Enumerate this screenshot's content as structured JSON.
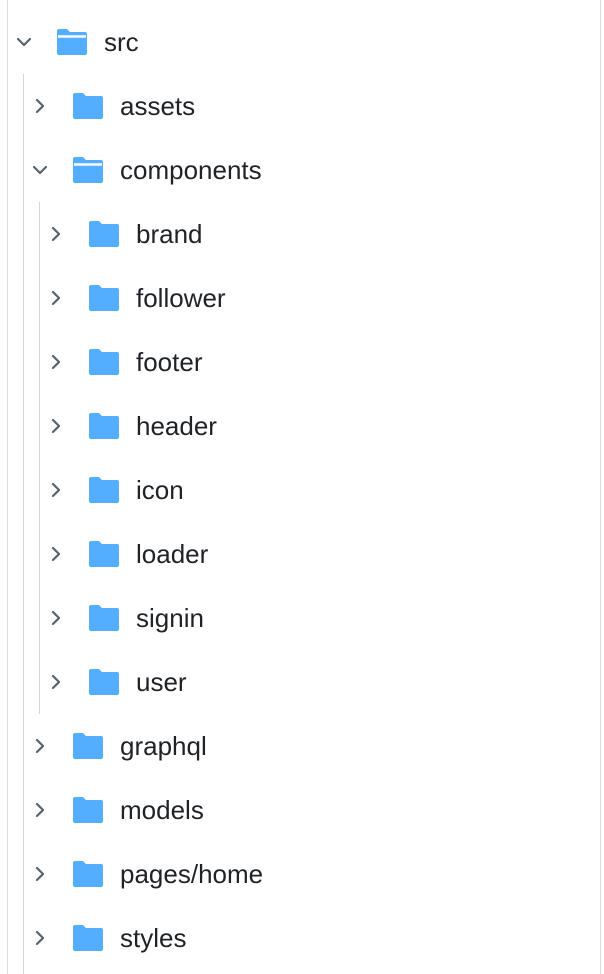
{
  "colors": {
    "folder": "#54aeff",
    "chevron": "#59636e",
    "text": "#1f2328",
    "guide": "#d0d7de"
  },
  "icons": {
    "expanded": "chevron-down-icon",
    "collapsed": "chevron-right-icon",
    "folder_open": "folder-open-icon",
    "folder_closed": "folder-icon"
  },
  "tree": {
    "root": {
      "label": "src",
      "expanded": true
    },
    "src_children": [
      {
        "label": "assets",
        "expanded": false
      },
      {
        "label": "components",
        "expanded": true
      },
      {
        "label": "graphql",
        "expanded": false
      },
      {
        "label": "models",
        "expanded": false
      },
      {
        "label": "pages/home",
        "expanded": false
      },
      {
        "label": "styles",
        "expanded": false
      }
    ],
    "components_children": [
      {
        "label": "brand",
        "expanded": false
      },
      {
        "label": "follower",
        "expanded": false
      },
      {
        "label": "footer",
        "expanded": false
      },
      {
        "label": "header",
        "expanded": false
      },
      {
        "label": "icon",
        "expanded": false
      },
      {
        "label": "loader",
        "expanded": false
      },
      {
        "label": "signin",
        "expanded": false
      },
      {
        "label": "user",
        "expanded": false
      }
    ]
  }
}
